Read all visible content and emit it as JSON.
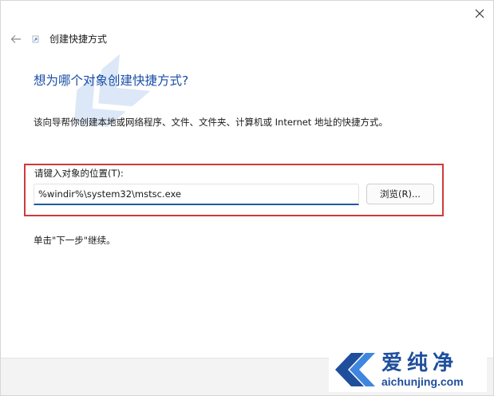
{
  "wizard": {
    "title": "创建快捷方式"
  },
  "page": {
    "heading": "想为哪个对象创建快捷方式?",
    "description": "该向导帮你创建本地或网络程序、文件、文件夹、计算机或 Internet 地址的快捷方式。",
    "location_label": "请键入对象的位置(T):",
    "location_value": "%windir%\\system32\\mstsc.exe",
    "browse_label": "浏览(R)...",
    "continue_hint": "单击\"下一步\"继续。"
  },
  "watermark": {
    "brand_text": "爱纯净",
    "domain_text": "aichunjing.com"
  },
  "colors": {
    "accent": "#1a4fa8",
    "highlight_border": "#cf3b3b",
    "input_underline": "#1f5aa6",
    "watermark_blue": "#1f4f9c"
  },
  "icons": {
    "close": "close-icon",
    "back": "back-arrow-icon",
    "wizard": "shortcut-wizard-icon",
    "watermark": "aichunjing-logo"
  }
}
